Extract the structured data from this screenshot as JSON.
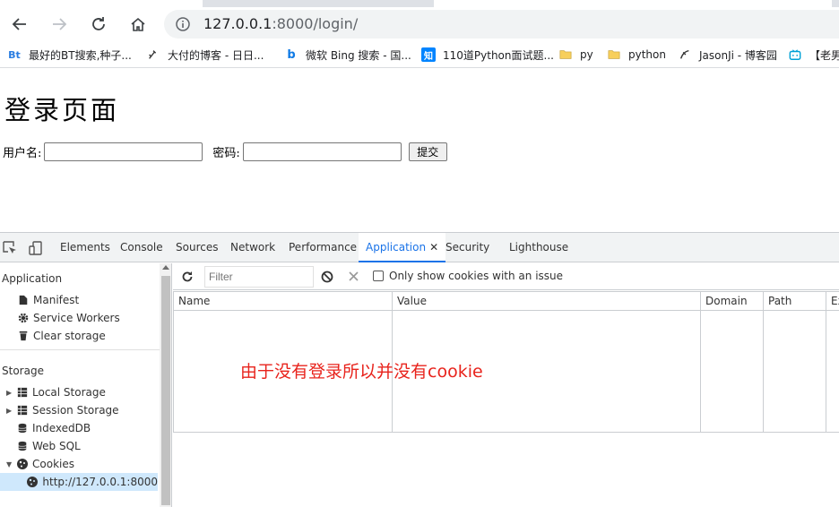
{
  "browser": {
    "url_host": "127.0.0.1",
    "url_path": ":8000/login/"
  },
  "bookmarks": [
    {
      "icon": "bt-icon",
      "icon_text": "Bt",
      "label": "最好的BT搜索,种子..."
    },
    {
      "icon": "blog-icon",
      "icon_text": "",
      "label": "大付的博客 - 日日..."
    },
    {
      "icon": "bing-icon",
      "icon_text": "b",
      "label": "微软 Bing 搜索 - 国..."
    },
    {
      "icon": "zhihu-icon",
      "icon_text": "知",
      "label": "110道Python面试题..."
    },
    {
      "icon": "folder-icon",
      "icon_text": "",
      "label": "py"
    },
    {
      "icon": "folder-icon",
      "icon_text": "",
      "label": "python"
    },
    {
      "icon": "cnblogs-icon",
      "icon_text": "",
      "label": "JasonJi - 博客园"
    },
    {
      "icon": "bilibili-icon",
      "icon_text": "",
      "label": "【老男"
    }
  ],
  "page": {
    "title": "登录页面",
    "username_label": "用户名:",
    "password_label": "密码:",
    "submit_label": "提交"
  },
  "devtools": {
    "tabs": [
      "Elements",
      "Console",
      "Sources",
      "Network",
      "Performance",
      "Application",
      "Security",
      "Lighthouse"
    ],
    "active_tab": "Application",
    "sidebar": {
      "application_section": "Application",
      "application_items": [
        "Manifest",
        "Service Workers",
        "Clear storage"
      ],
      "storage_section": "Storage",
      "storage_items": [
        "Local Storage",
        "Session Storage",
        "IndexedDB",
        "Web SQL",
        "Cookies"
      ],
      "cookie_origin": "http://127.0.0.1:8000"
    },
    "toolbar": {
      "filter_placeholder": "Filter",
      "only_issue_label": "Only show cookies with an issue"
    },
    "table_columns": [
      "Name",
      "Value",
      "Domain",
      "Path",
      "Ex"
    ]
  },
  "annotation": "由于没有登录所以并没有cookie",
  "colors": {
    "accent": "#1a73e8",
    "annotation": "#e8231c",
    "selected_row": "#cfe8fc"
  }
}
